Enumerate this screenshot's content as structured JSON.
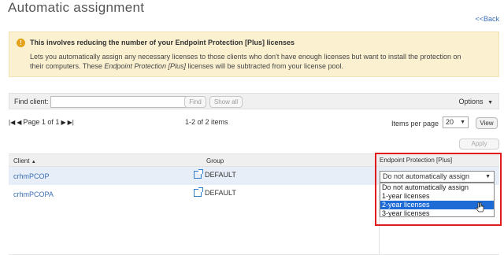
{
  "page": {
    "title": "Automatic assignment",
    "back_link": "<<Back"
  },
  "info": {
    "title": "This involves reducing the number of your Endpoint Protection [Plus] licenses",
    "text_line1": "Lets you automatically assign any necessary licenses to those clients who don't have enough licenses but want to install the protection on",
    "text_line2_prefix": "their computers. These ",
    "text_line2_em": "Endpoint Protection [Plus]",
    "text_line2_suffix": " licenses will be subtracted from your license pool."
  },
  "find": {
    "label": "Find client:",
    "value": "",
    "find_button": "Find",
    "show_all_button": "Show all",
    "options_label": "Options"
  },
  "pager": {
    "page_text": "Page 1 of 1",
    "items_text": "1-2 of 2 items",
    "items_per_page_label": "Items per page",
    "items_per_page_value": "20",
    "view_button": "View"
  },
  "apply_button": "Apply",
  "table": {
    "headers": {
      "client": "Client",
      "group": "Group",
      "endpoint": "Endpoint Protection [Plus]"
    },
    "rows": [
      {
        "client": "crhmPCOP",
        "group": "DEFAULT"
      },
      {
        "client": "crhmPCOPA",
        "group": "DEFAULT"
      }
    ]
  },
  "dropdown": {
    "selected_value": "Do not automatically assign",
    "options": [
      "Do not automatically assign",
      "1-year licenses",
      "2-year licenses",
      "3-year licenses"
    ],
    "highlighted": "2-year licenses"
  },
  "colors": {
    "link": "#3b6fb6",
    "highlight": "#1e6bd6",
    "frame": "#e11b1b",
    "info_bg": "#fbf1d1"
  },
  "icons": {
    "warning": "warning-icon",
    "sort_asc": "sort-ascending-icon",
    "group": "external-group-icon",
    "first": "first-page-icon",
    "prev": "previous-page-icon",
    "next": "next-page-icon",
    "last": "last-page-icon"
  }
}
